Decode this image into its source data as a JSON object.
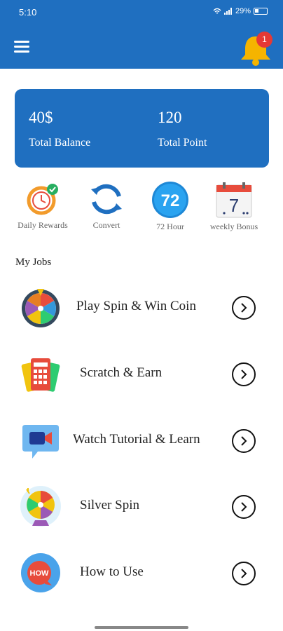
{
  "status": {
    "time": "5:10",
    "battery": "29%"
  },
  "header": {
    "notification_count": "1"
  },
  "balance": {
    "balance_value": "40$",
    "balance_label": "Total Balance",
    "point_value": "120",
    "point_label": "Total Point"
  },
  "quick_actions": [
    {
      "label": "Daily Rewards",
      "icon": "clock-check-icon"
    },
    {
      "label": "Convert",
      "icon": "refresh-icon"
    },
    {
      "label": "72 Hour",
      "icon": "72-badge-icon",
      "badge_text": "72"
    },
    {
      "label": "weekly Bonus",
      "icon": "calendar-icon",
      "badge_text": "7"
    }
  ],
  "jobs_title": "My Jobs",
  "jobs": [
    {
      "label": "Play Spin  & Win Coin",
      "icon": "spin-wheel-icon"
    },
    {
      "label": "Scratch & Earn",
      "icon": "scratch-card-icon"
    },
    {
      "label": "Watch Tutorial & Learn",
      "icon": "video-camera-icon"
    },
    {
      "label": "Silver Spin",
      "icon": "silver-wheel-icon"
    },
    {
      "label": "How to Use",
      "icon": "how-badge-icon",
      "badge_text": "HOW"
    }
  ],
  "colors": {
    "primary": "#1f6fc0",
    "bell": "#f5b400",
    "badge": "#e53935"
  }
}
